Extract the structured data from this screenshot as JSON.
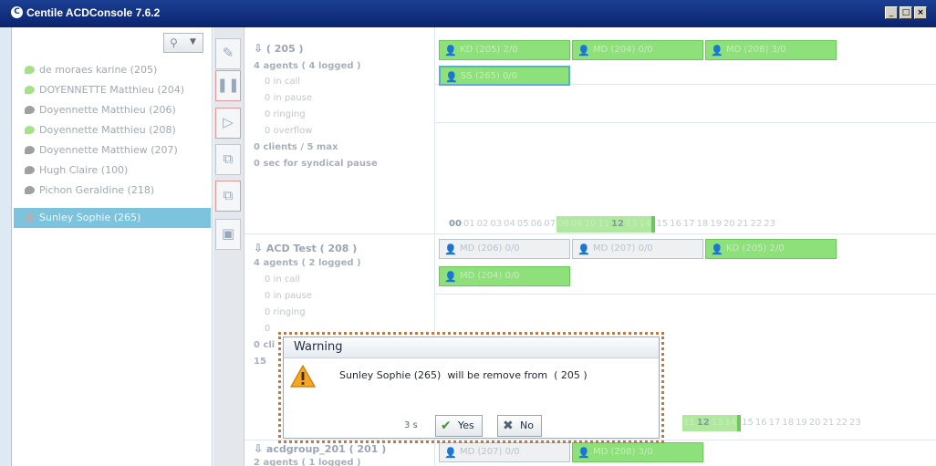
{
  "window": {
    "logo_letter": "C",
    "title": "Centile ACDConsole 7.6.2",
    "controls": {
      "minimize": "_",
      "maximize": "□",
      "close": "×"
    }
  },
  "sidebar": {
    "search_icon": "magnifier-icon",
    "agents": [
      {
        "label": "de moraes karine (205)",
        "status_color": "#a6e08a"
      },
      {
        "label": "DOYENNETTE Matthieu (204)",
        "status_color": "#a6e08a"
      },
      {
        "label": "Doyennette Matthieu (206)",
        "status_color": "#a0a0a0"
      },
      {
        "label": "Doyennette Matthieu (208)",
        "status_color": "#a6e08a"
      },
      {
        "label": "Doyennette Matthiew (207)",
        "status_color": "#a0a0a0"
      },
      {
        "label": "Hugh Claire (100)",
        "status_color": "#a0a0a0"
      },
      {
        "label": "Pichon Geraldine (218)",
        "status_color": "#a0a0a0"
      },
      {
        "label": "Sunley Sophie (265)",
        "status_color": "#a8b4bc",
        "selected": true
      }
    ]
  },
  "toolbar": {
    "icons": [
      "edit-queue-icon",
      "pause-icon",
      "play-icon",
      "assign-agent-icon",
      "remove-agent-icon",
      "delete-icon"
    ]
  },
  "queues": [
    {
      "title": "( 205 )",
      "agents_line": "4 agents ( 4 logged )",
      "in_call": "0 in call",
      "in_pause": "0 in pause",
      "ringing": "0 ringing",
      "overflow": "0 overflow",
      "clients": "0 clients / 5 max",
      "syndical": "0 sec for syndical pause",
      "badges": [
        {
          "label": "KD (205)  2/0",
          "active": true
        },
        {
          "label": "MD (204)  0/0",
          "active": true
        },
        {
          "label": "MD (208)  3/0",
          "active": true
        },
        {
          "label": "SS (265)  0/0",
          "active": true,
          "selected": true
        }
      ]
    },
    {
      "title": "ACD Test ( 208 )",
      "agents_line": "4 agents ( 2 logged )",
      "in_call": "0 in call",
      "in_pause": "0 in pause",
      "ringing": "0 ringing",
      "overflow": "0",
      "clients": "0 cli",
      "syndical": "15",
      "badges": [
        {
          "label": "MD (206)  0/0",
          "active": false
        },
        {
          "label": "MD (207)  0/0",
          "active": false
        },
        {
          "label": "KD (205)  2/0",
          "active": true
        },
        {
          "label": "MD (204)  0/0",
          "active": true
        }
      ]
    },
    {
      "title": "acdgroup_201 ( 201 )",
      "agents_line": "2 agents ( 1 logged )",
      "badges": [
        {
          "label": "MD (207)  0/0",
          "active": false
        },
        {
          "label": "MD (208)  3/0",
          "active": true
        }
      ]
    }
  ],
  "hours": [
    "00",
    "01",
    "02",
    "03",
    "04",
    "05",
    "06",
    "07",
    "08",
    "09",
    "10",
    "11",
    "12",
    "13",
    "14",
    "15",
    "16",
    "17",
    "18",
    "19",
    "20",
    "21",
    "22",
    "23"
  ],
  "hours_partial": [
    "11",
    "12",
    "13",
    "14",
    "15",
    "16",
    "17",
    "18",
    "19",
    "20",
    "21",
    "22",
    "23"
  ],
  "dialog": {
    "title": "Warning",
    "icon": "warning-triangle-icon",
    "message": "Sunley Sophie (265)  will be remove from  ( 205 )",
    "timer": "3 s",
    "yes_label": "Yes",
    "no_label": "No"
  },
  "colors": {
    "title_bar": "#0f2d7c",
    "selected_row": "#7cc3de",
    "active_badge": "#8ee07a",
    "highlight_outline": "#e07020"
  }
}
